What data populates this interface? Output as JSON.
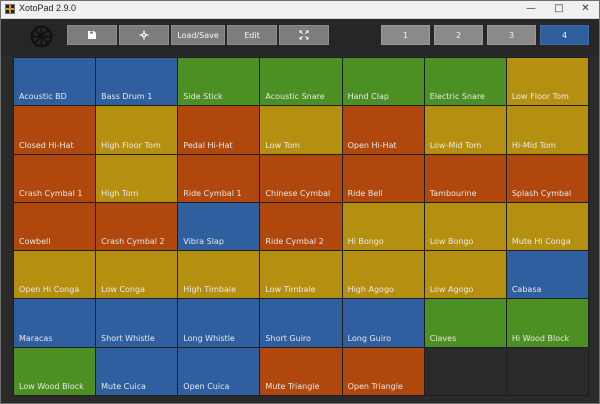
{
  "window": {
    "title": "XotoPad 2.9.0",
    "controls": [
      "—",
      "□",
      "✕"
    ]
  },
  "toolbar": {
    "load_save_label": "Load/Save",
    "edit_label": "Edit",
    "banks": [
      {
        "label": "1",
        "active": false
      },
      {
        "label": "2",
        "active": false
      },
      {
        "label": "3",
        "active": false
      },
      {
        "label": "4",
        "active": true
      }
    ]
  },
  "colors": {
    "blue": "#2f5f9e",
    "green": "#4c8f22",
    "orange": "#b0470d",
    "yellow": "#b59010"
  },
  "pads": [
    {
      "label": "Acoustic BD",
      "color": "blue"
    },
    {
      "label": "Bass Drum 1",
      "color": "blue"
    },
    {
      "label": "Side Stick",
      "color": "green"
    },
    {
      "label": "Acoustic Snare",
      "color": "green"
    },
    {
      "label": "Hand Clap",
      "color": "green"
    },
    {
      "label": "Electric Snare",
      "color": "green"
    },
    {
      "label": "Low Floor Tom",
      "color": "yellow"
    },
    {
      "label": "Closed Hi-Hat",
      "color": "orange"
    },
    {
      "label": "High Floor Tom",
      "color": "yellow"
    },
    {
      "label": "Pedal Hi-Hat",
      "color": "orange"
    },
    {
      "label": "Low Tom",
      "color": "yellow"
    },
    {
      "label": "Open Hi-Hat",
      "color": "orange"
    },
    {
      "label": "Low-Mid Tom",
      "color": "yellow"
    },
    {
      "label": "Hi-Mid Tom",
      "color": "yellow"
    },
    {
      "label": "Crash Cymbal 1",
      "color": "orange"
    },
    {
      "label": "High Tom",
      "color": "yellow"
    },
    {
      "label": "Ride Cymbal 1",
      "color": "orange"
    },
    {
      "label": "Chinese Cymbal",
      "color": "orange"
    },
    {
      "label": "Ride Bell",
      "color": "orange"
    },
    {
      "label": "Tambourine",
      "color": "orange"
    },
    {
      "label": "Splash Cymbal",
      "color": "orange"
    },
    {
      "label": "Cowbell",
      "color": "orange"
    },
    {
      "label": "Crash Cymbal 2",
      "color": "orange"
    },
    {
      "label": "Vibra Slap",
      "color": "blue"
    },
    {
      "label": "Ride Cymbal 2",
      "color": "orange"
    },
    {
      "label": "Hi Bongo",
      "color": "yellow"
    },
    {
      "label": "Low Bongo",
      "color": "yellow"
    },
    {
      "label": "Mute Hi Conga",
      "color": "yellow"
    },
    {
      "label": "Open Hi Conga",
      "color": "yellow"
    },
    {
      "label": "Low Conga",
      "color": "yellow"
    },
    {
      "label": "High Timbale",
      "color": "yellow"
    },
    {
      "label": "Low Timbale",
      "color": "yellow"
    },
    {
      "label": "High Agogo",
      "color": "yellow"
    },
    {
      "label": "Low Agogo",
      "color": "yellow"
    },
    {
      "label": "Cabasa",
      "color": "blue"
    },
    {
      "label": "Maracas",
      "color": "blue"
    },
    {
      "label": "Short Whistle",
      "color": "blue"
    },
    {
      "label": "Long Whistle",
      "color": "blue"
    },
    {
      "label": "Short Guiro",
      "color": "blue"
    },
    {
      "label": "Long Guiro",
      "color": "blue"
    },
    {
      "label": "Claves",
      "color": "green"
    },
    {
      "label": "Hi Wood Block",
      "color": "green"
    },
    {
      "label": "Low Wood Block",
      "color": "green"
    },
    {
      "label": "Mute Cuica",
      "color": "blue"
    },
    {
      "label": "Open Cuica",
      "color": "blue"
    },
    {
      "label": "Mute Triangle",
      "color": "orange"
    },
    {
      "label": "Open Triangle",
      "color": "orange"
    },
    {
      "label": "",
      "color": "empty"
    },
    {
      "label": "",
      "color": "empty"
    }
  ]
}
